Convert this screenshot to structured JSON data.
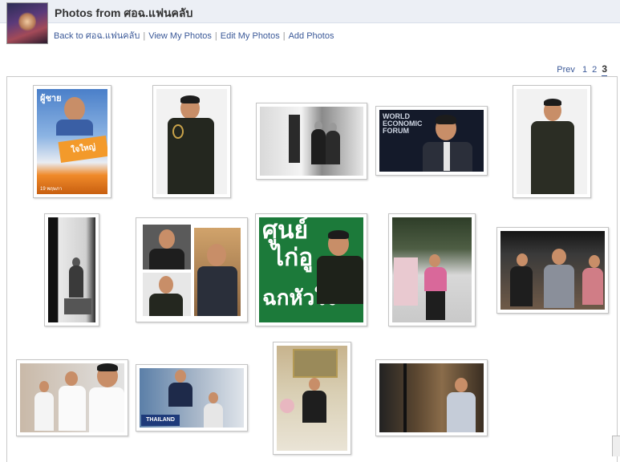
{
  "page": {
    "title": "Photos from ศอฉ.แฟนคลับ"
  },
  "subnav": {
    "back": "Back to ศอฉ.แฟนคลับ",
    "view_my_photos": "View My Photos",
    "edit_my_photos": "Edit My Photos",
    "add_photos": "Add Photos",
    "separator": "|"
  },
  "pagination": {
    "prev": "Prev",
    "pages": [
      "1",
      "2",
      "3"
    ],
    "current": "3"
  },
  "photos": {
    "p1": {
      "text_top": "ผู้ชาย",
      "text_mid": "ใจใหญ่",
      "text_bottom": "19 พฤษภา"
    },
    "p4": {
      "text_line1": "WORLD",
      "text_line2": "ECONOMIC",
      "text_line3": "FORUM"
    },
    "p8": {
      "text_line1": "ศูนย์",
      "text_line2": "ไก่อู",
      "text_line3": "ฉกหัวใจ"
    },
    "p13": {
      "sign": "THAILAND"
    }
  },
  "colors": {
    "link": "#3b5998",
    "header_band": "#eceff5",
    "green_poster": "#1c7a3a"
  }
}
